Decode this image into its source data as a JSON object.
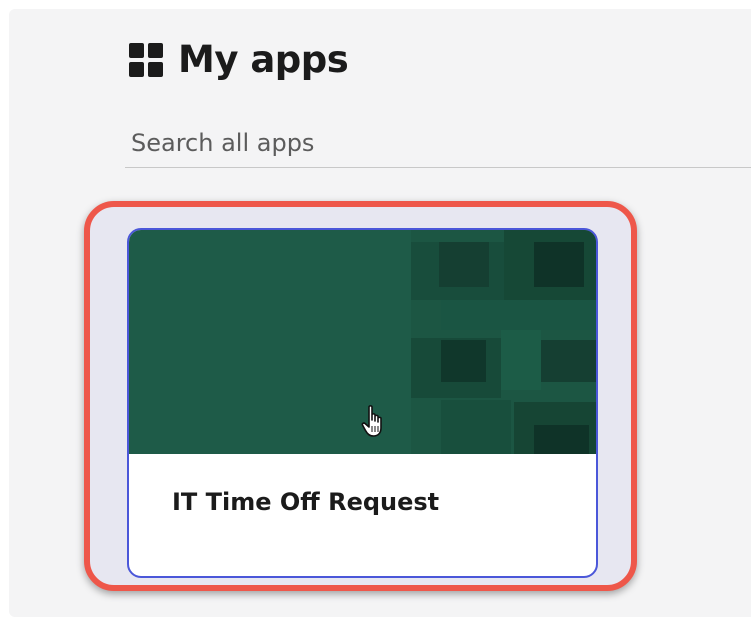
{
  "header": {
    "title": "My apps",
    "icon": "apps-grid-icon"
  },
  "search": {
    "placeholder": "Search all apps",
    "value": ""
  },
  "apps": [
    {
      "name": "IT Time Off Request",
      "banner_color": "#1e5b48",
      "highlighted": true
    }
  ],
  "colors": {
    "highlight_ring": "#ee574a",
    "card_focus_border": "#4b57d9",
    "banner": "#1e5b48",
    "panel_background": "#f4f4f5"
  },
  "cursor": "pointer-hand-icon"
}
